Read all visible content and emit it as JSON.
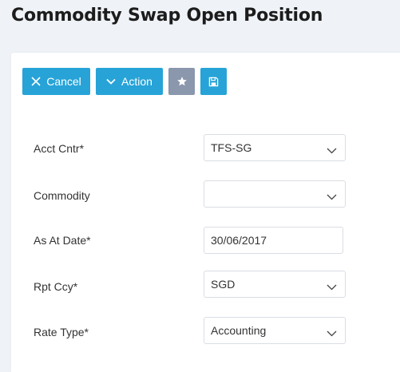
{
  "header": {
    "title": "Commodity Swap Open Position"
  },
  "toolbar": {
    "cancel_label": "Cancel",
    "action_label": "Action"
  },
  "form": {
    "acct_cntr": {
      "label": "Acct Cntr*",
      "value": "TFS-SG"
    },
    "commodity": {
      "label": "Commodity",
      "value": ""
    },
    "as_at_date": {
      "label": "As At Date*",
      "value": "30/06/2017"
    },
    "rpt_ccy": {
      "label": "Rpt Ccy*",
      "value": "SGD"
    },
    "rate_type": {
      "label": "Rate Type*",
      "value": "Accounting"
    }
  },
  "icons": {
    "cancel": "close-icon",
    "action": "chevron-down-icon",
    "favorite": "star-icon",
    "save": "save-icon",
    "dropdown": "chevron-down-icon"
  },
  "colors": {
    "primary_button": "#27a3d7",
    "favorite_button": "#8a97ad",
    "page_background": "#eff2f6"
  }
}
